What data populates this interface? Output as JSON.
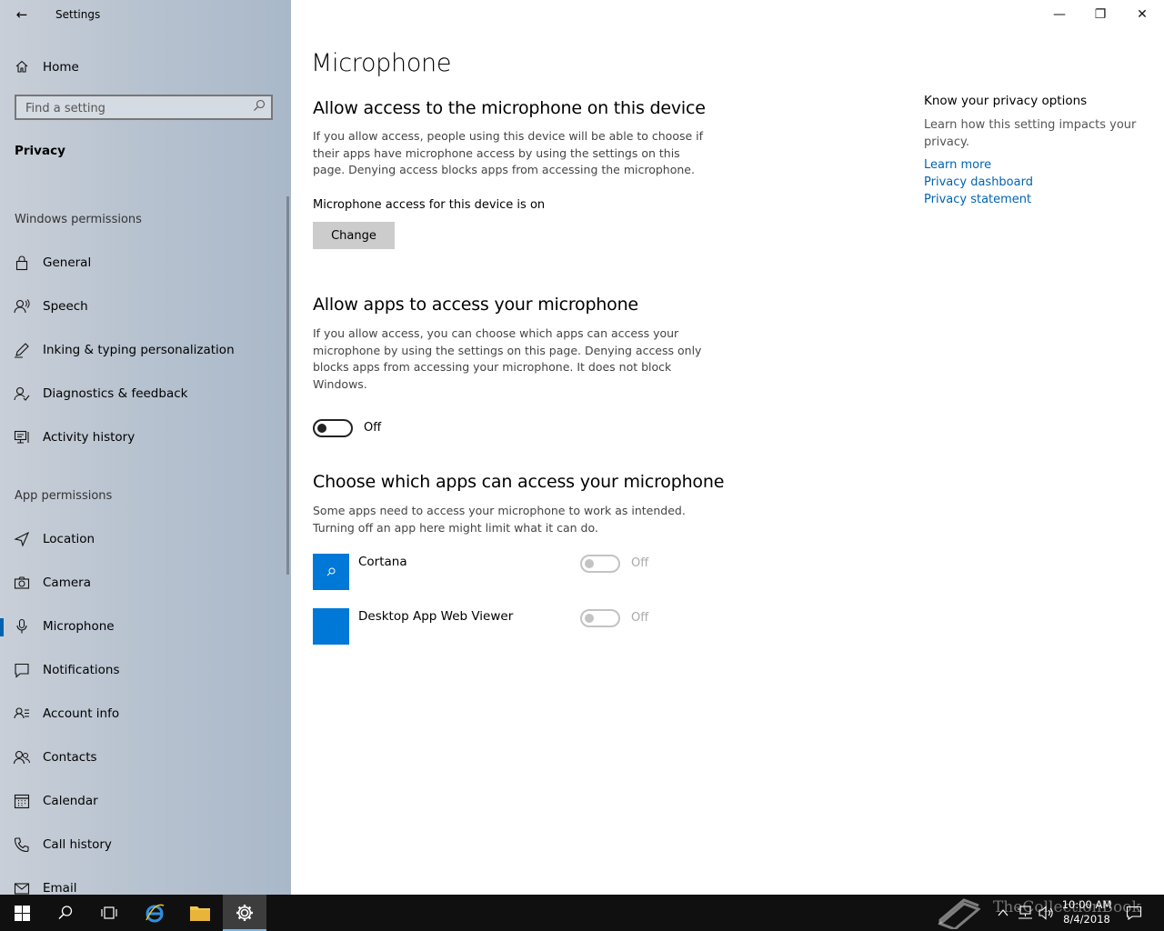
{
  "window": {
    "title": "Settings",
    "back": "←",
    "minimize": "—",
    "restore": "❐",
    "close": "✕"
  },
  "sidebar": {
    "home_label": "Home",
    "search_placeholder": "Find a setting",
    "current_section": "Privacy",
    "windows_permissions_header": "Windows permissions",
    "windows_permissions": [
      {
        "label": "General",
        "icon": "lock-icon"
      },
      {
        "label": "Speech",
        "icon": "speech-icon"
      },
      {
        "label": "Inking & typing personalization",
        "icon": "inking-icon"
      },
      {
        "label": "Diagnostics & feedback",
        "icon": "diagnostics-icon"
      },
      {
        "label": "Activity history",
        "icon": "activity-icon"
      }
    ],
    "app_permissions_header": "App permissions",
    "app_permissions": [
      {
        "label": "Location",
        "icon": "location-icon"
      },
      {
        "label": "Camera",
        "icon": "camera-icon"
      },
      {
        "label": "Microphone",
        "icon": "microphone-icon",
        "selected": true
      },
      {
        "label": "Notifications",
        "icon": "notifications-icon"
      },
      {
        "label": "Account info",
        "icon": "account-info-icon"
      },
      {
        "label": "Contacts",
        "icon": "contacts-icon"
      },
      {
        "label": "Calendar",
        "icon": "calendar-icon"
      },
      {
        "label": "Call history",
        "icon": "call-history-icon"
      },
      {
        "label": "Email",
        "icon": "email-icon"
      }
    ]
  },
  "main": {
    "title": "Microphone",
    "device_section": {
      "heading": "Allow access to the microphone on this device",
      "description": "If you allow access, people using this device will be able to choose if their apps have microphone access by using the settings on this page. Denying access blocks apps from accessing the microphone.",
      "status": "Microphone access for this device is on",
      "change_label": "Change"
    },
    "apps_section": {
      "heading": "Allow apps to access your microphone",
      "description": "If you allow access, you can choose which apps can access your microphone by using the settings on this page. Denying access only blocks apps from accessing your microphone. It does not block Windows.",
      "toggle_label": "Off"
    },
    "choose_section": {
      "heading": "Choose which apps can access your microphone",
      "description": "Some apps need to access your microphone to work as intended. Turning off an app here might limit what it can do.",
      "apps": [
        {
          "name": "Cortana",
          "toggle_label": "Off",
          "icon": "cortana-icon"
        },
        {
          "name": "Desktop App Web Viewer",
          "toggle_label": "Off",
          "icon": "app-tile-icon"
        }
      ]
    },
    "side_panel": {
      "title": "Know your privacy options",
      "description": "Learn how this setting impacts your privacy.",
      "links": [
        "Learn more",
        "Privacy dashboard",
        "Privacy statement"
      ]
    }
  },
  "taskbar": {
    "time": "10:00 AM",
    "date": "8/4/2018",
    "watermark": "TheCollectionBook"
  },
  "colors": {
    "accent": "#0078d7",
    "link": "#0063b1",
    "taskbar": "#101010"
  }
}
